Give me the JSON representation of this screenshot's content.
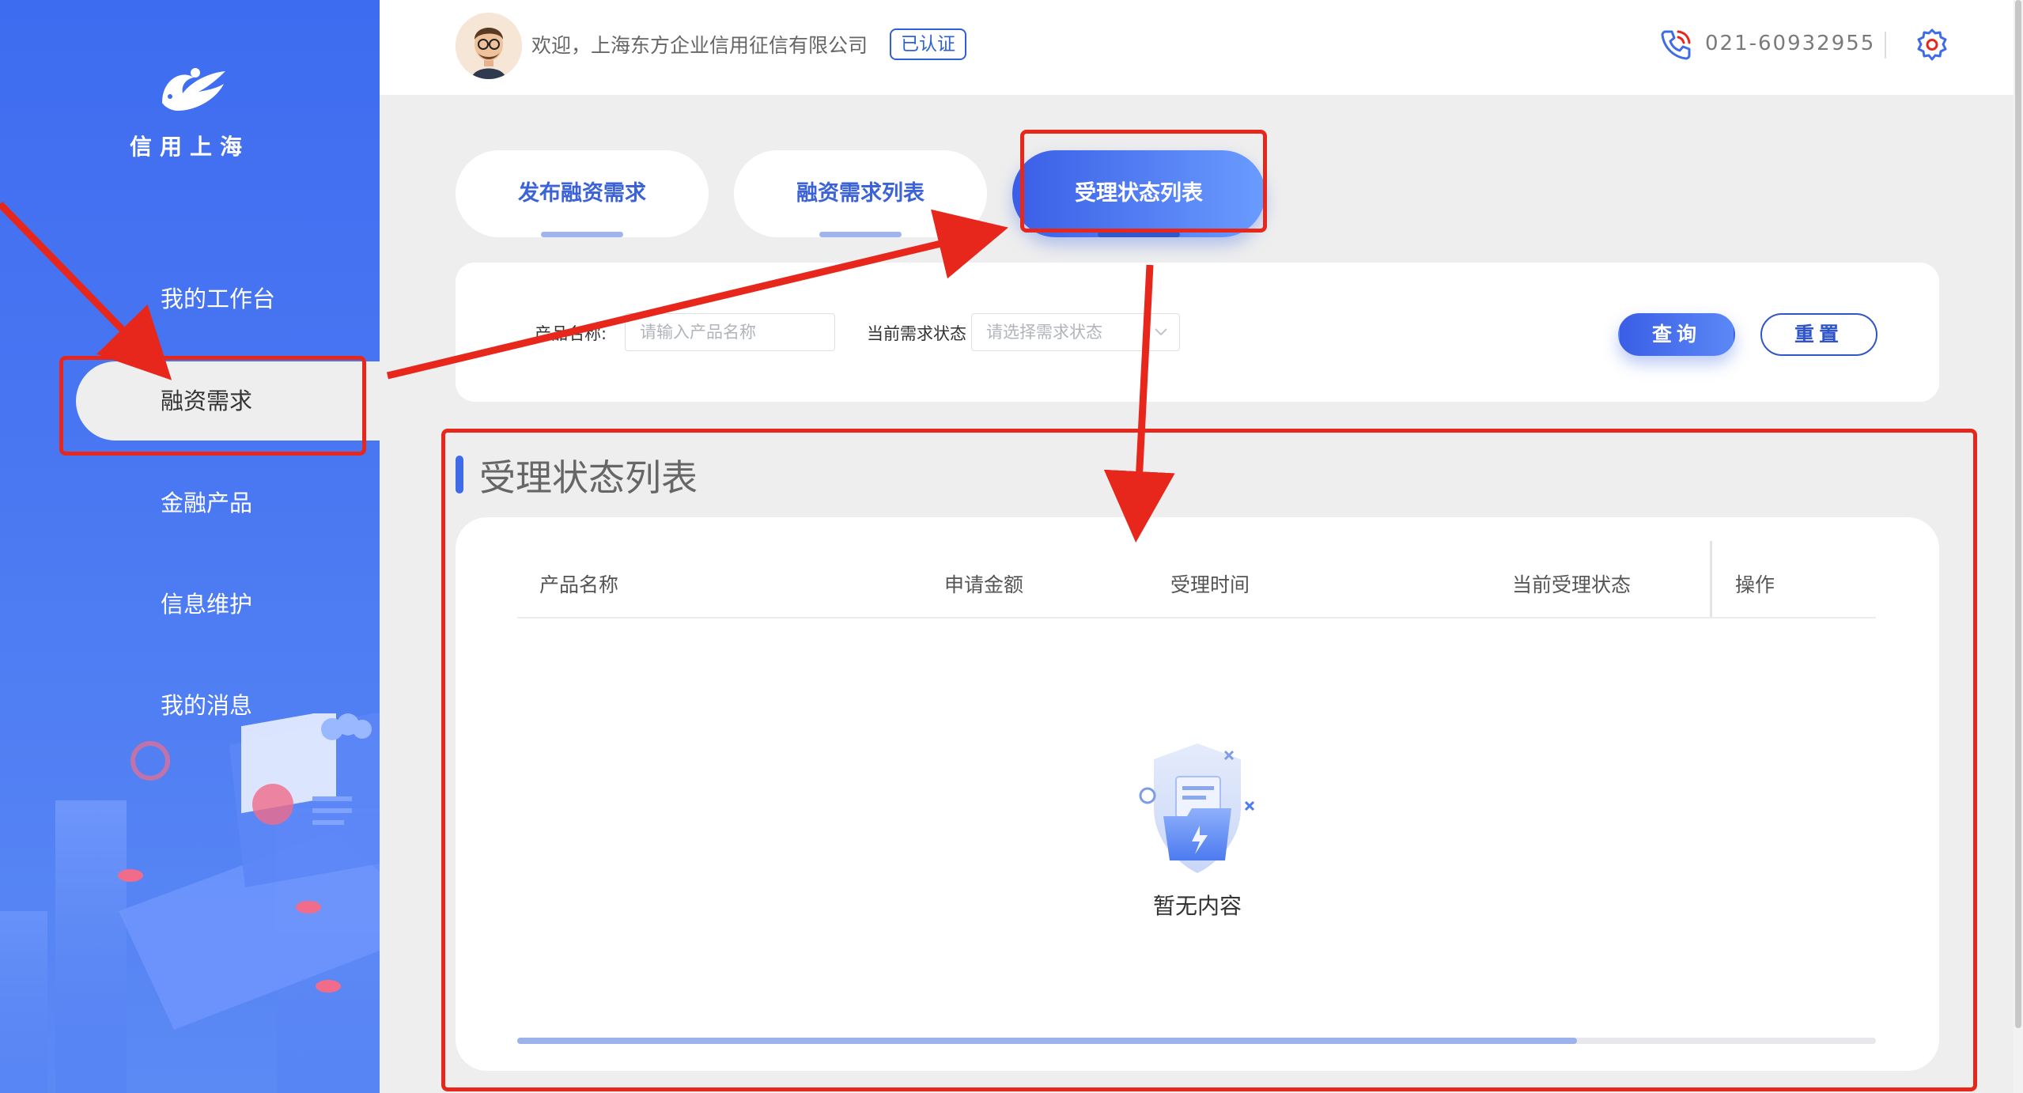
{
  "sidebar": {
    "logo_text": "信用上海",
    "items": [
      {
        "label": "我的工作台"
      },
      {
        "label": "融资需求"
      },
      {
        "label": "金融产品"
      },
      {
        "label": "信息维护"
      },
      {
        "label": "我的消息"
      }
    ],
    "active_index": 1
  },
  "header": {
    "welcome": "欢迎，上海东方企业信用征信有限公司",
    "badge": "已认证",
    "phone": "021-60932955"
  },
  "tabs": [
    {
      "label": "发布融资需求"
    },
    {
      "label": "融资需求列表"
    },
    {
      "label": "受理状态列表"
    }
  ],
  "active_tab": 2,
  "search": {
    "product_label": "产品名称:",
    "product_placeholder": "请输入产品名称",
    "status_label": "当前需求状态",
    "status_placeholder": "请选择需求状态",
    "query_button": "查询",
    "reset_button": "重置"
  },
  "section_title": "受理状态列表",
  "table": {
    "columns": [
      "产品名称",
      "申请金额",
      "受理时间",
      "当前受理状态",
      "操作"
    ],
    "rows": [],
    "empty_text": "暂无内容",
    "scroll_position": 0.78
  },
  "colors": {
    "brand": "#3e6cf0",
    "annotation": "#e8271c"
  }
}
